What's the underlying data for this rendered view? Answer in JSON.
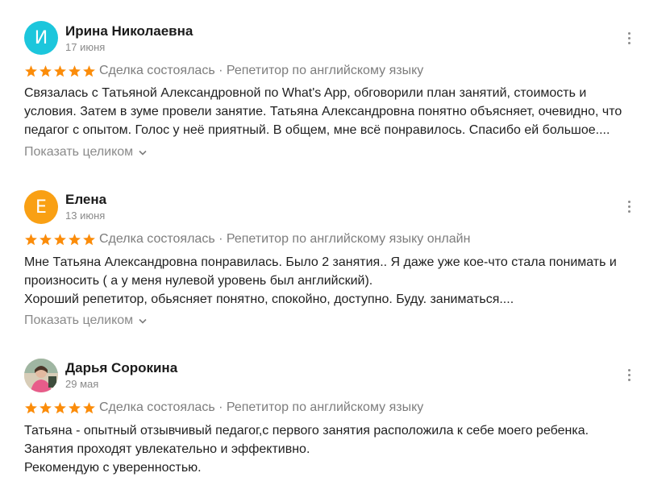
{
  "colors": {
    "star": "#fb8c0a",
    "avatar_irina": "#1cc6dc",
    "avatar_elena": "#f9a014"
  },
  "reviews": [
    {
      "avatar_letter": "И",
      "author": "Ирина Николаевна",
      "date": "17 июня",
      "rating": 5,
      "meta": "Сделка состоялась · Репетитор по английскому языку",
      "text": "Связалась с Татьяной Александровной по What's App, обговорили план занятий, стоимость и условия. Затем в зуме провели занятие. Татьяна Александровна понятно объясняет, очевидно, что педагог с опытом. Голос у неё приятный. В общем, мне всё понравилось. Спасибо ей большое....",
      "show_all": "Показать целиком"
    },
    {
      "avatar_letter": "Е",
      "author": "Елена",
      "date": "13 июня",
      "rating": 5,
      "meta": "Сделка состоялась · Репетитор по английскому языку онлайн",
      "text": "Мне Татьяна Александровна понравилась. Было 2 занятия.. Я даже уже кое-что стала понимать и произносить ( а у меня нулевой уровень был английский).\nХороший репетитор, обьясняет понятно, спокойно, доступно. Буду. заниматься....",
      "show_all": "Показать целиком"
    },
    {
      "avatar_letter": "",
      "author": "Дарья Сорокина",
      "date": "29 мая",
      "rating": 5,
      "meta": "Сделка состоялась · Репетитор по английскому языку",
      "text": "Татьяна - опытный отзывчивый педагог,с первого занятия расположила к себе моего ребенка.\nЗанятия проходят увлекательно и эффективно.\nРекомендую с уверенностью."
    }
  ]
}
